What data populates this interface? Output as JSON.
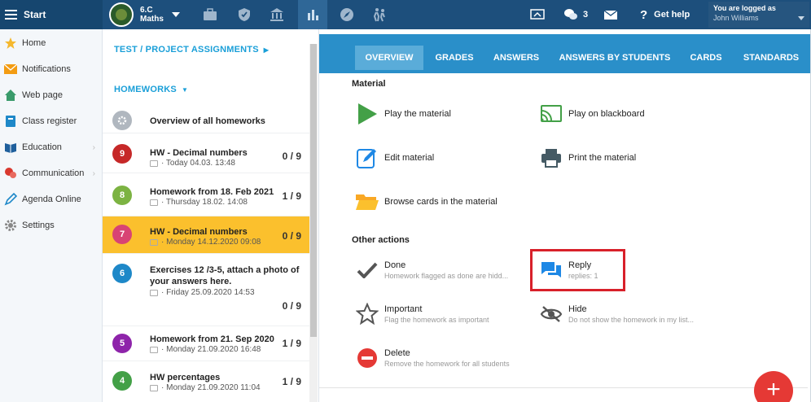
{
  "topbar": {
    "start_label": "Start",
    "class_line1": "6.C",
    "class_line2": "Maths",
    "message_count": "3",
    "help_label": "Get help",
    "logged_in_label": "You are logged as",
    "user_name": "John Williams"
  },
  "sidebar": {
    "items": [
      {
        "label": "Home",
        "icon": "star-icon"
      },
      {
        "label": "Notifications",
        "icon": "envelope-icon"
      },
      {
        "label": "Web page",
        "icon": "house-icon"
      },
      {
        "label": "Class register",
        "icon": "book-icon"
      },
      {
        "label": "Education",
        "icon": "open-book-icon"
      },
      {
        "label": "Communication",
        "icon": "chat-icon"
      },
      {
        "label": "Agenda Online",
        "icon": "pen-icon"
      },
      {
        "label": "Settings",
        "icon": "gear-icon"
      }
    ]
  },
  "middle": {
    "test_section": "TEST / PROJECT ASSIGNMENTS",
    "homework_section": "HOMEWORKS",
    "overview_label": "Overview of all homeworks",
    "homeworks": [
      {
        "badge": "9",
        "color": "#c62828",
        "title": "HW - Decimal numbers",
        "title2": "",
        "date": "· Today 04.03. 13:48",
        "score": "0 / 9"
      },
      {
        "badge": "8",
        "color": "#7cb342",
        "title": "Homework from 18. Feb 2021",
        "title2": "",
        "date": "· Thursday 18.02. 14:08",
        "score": "1 / 9"
      },
      {
        "badge": "7",
        "color": "#d84374",
        "title": "HW - Decimal numbers",
        "title2": "",
        "date": "· Monday 14.12.2020 09:08",
        "score": "0 / 9"
      },
      {
        "badge": "6",
        "color": "#1e88c8",
        "title": "Exercises 12 /3-5, attach a photo of",
        "title2": "your answers here.",
        "date": "· Friday 25.09.2020 14:53",
        "score": "0 / 9"
      },
      {
        "badge": "5",
        "color": "#8e24aa",
        "title": "Homework from 21. Sep 2020",
        "title2": "",
        "date": "· Monday 21.09.2020 16:48",
        "score": "1 / 9"
      },
      {
        "badge": "4",
        "color": "#43a047",
        "title": "HW percentages",
        "title2": "",
        "date": "· Monday 21.09.2020 11:04",
        "score": "1 / 9"
      }
    ]
  },
  "tabs": [
    "OVERVIEW",
    "GRADES",
    "ANSWERS",
    "ANSWERS BY STUDENTS",
    "CARDS",
    "STANDARDS"
  ],
  "material": {
    "heading": "Material",
    "play": "Play the material",
    "blackboard": "Play on blackboard",
    "edit": "Edit material",
    "print": "Print the material",
    "browse": "Browse cards in the material"
  },
  "other": {
    "heading": "Other actions",
    "done": "Done",
    "done_sub": "Homework flagged as done are hidd...",
    "reply": "Reply",
    "reply_sub": "replies: 1",
    "important": "Important",
    "important_sub": "Flag the homework as important",
    "hide": "Hide",
    "hide_sub": "Do not show the homework in my list...",
    "delete": "Delete",
    "delete_sub": "Remove the homework for all students"
  },
  "colors": {
    "accent": "#2a8fc9",
    "selected_row": "#fbc02d",
    "highlight": "#d8202a"
  }
}
